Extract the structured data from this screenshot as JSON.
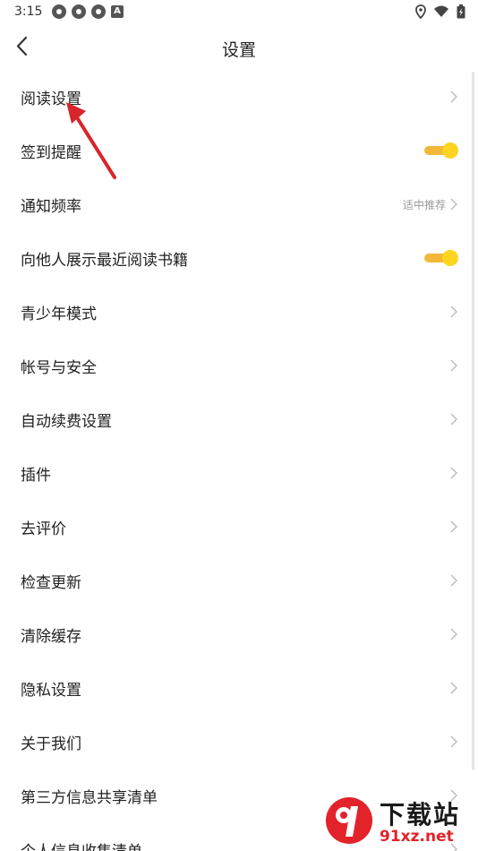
{
  "status_bar": {
    "time": "3:15"
  },
  "header": {
    "title": "设置"
  },
  "settings": [
    {
      "label": "阅读设置",
      "control": "chevron"
    },
    {
      "label": "签到提醒",
      "control": "toggle",
      "on": true
    },
    {
      "label": "通知频率",
      "control": "chevron",
      "value": "适中推荐"
    },
    {
      "label": "向他人展示最近阅读书籍",
      "control": "toggle",
      "on": true
    },
    {
      "label": "青少年模式",
      "control": "chevron"
    },
    {
      "label": "帐号与安全",
      "control": "chevron"
    },
    {
      "label": "自动续费设置",
      "control": "chevron"
    },
    {
      "label": "插件",
      "control": "chevron"
    },
    {
      "label": "去评价",
      "control": "chevron"
    },
    {
      "label": "检查更新",
      "control": "chevron"
    },
    {
      "label": "清除缓存",
      "control": "chevron"
    },
    {
      "label": "隐私设置",
      "control": "chevron"
    },
    {
      "label": "关于我们",
      "control": "chevron"
    },
    {
      "label": "第三方信息共享清单",
      "control": "chevron"
    },
    {
      "label": "个人信息收集清单",
      "control": "chevron"
    }
  ],
  "colors": {
    "toggle_track": "#f3b73a",
    "toggle_knob": "#ffd51f",
    "annotation": "#d8252b"
  },
  "watermark": {
    "title": "下载站",
    "url": "91xz.net"
  }
}
